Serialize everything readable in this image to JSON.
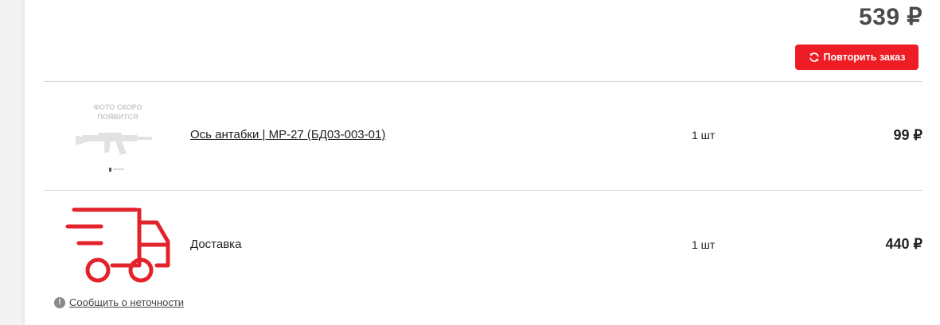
{
  "order": {
    "total": "539 ₽",
    "repeat_button_label": "Повторить заказ"
  },
  "items": [
    {
      "name": "Ось антабки | МР-27 (БД03-003-01)",
      "quantity": "1 шт",
      "price": "99 ₽",
      "placeholder_text": "ФОТО СКОРО ПОЯВИТСЯ"
    },
    {
      "name": "Доставка",
      "quantity": "1 шт",
      "price": "440 ₽"
    }
  ],
  "report_link": "Сообщить о неточности",
  "colors": {
    "accent": "#ee1c25",
    "truck": "#e3232b"
  },
  "icons": {
    "repeat": "refresh-icon",
    "delivery": "delivery-truck-icon",
    "info": "info-icon"
  }
}
